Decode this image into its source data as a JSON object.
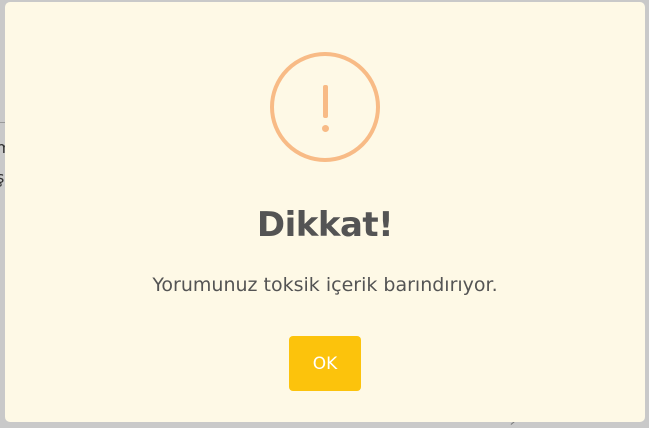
{
  "background": {
    "partial_chars": [
      "m",
      "ş"
    ]
  },
  "dialog": {
    "icon": "exclamation-circle-icon",
    "icon_color": "#f8bb86",
    "title": "Dikkat!",
    "message": "Yorumunuz toksik içerik barındırıyor.",
    "confirm_label": "OK",
    "confirm_color": "#fcc30c",
    "background_color": "#fef9e6"
  }
}
